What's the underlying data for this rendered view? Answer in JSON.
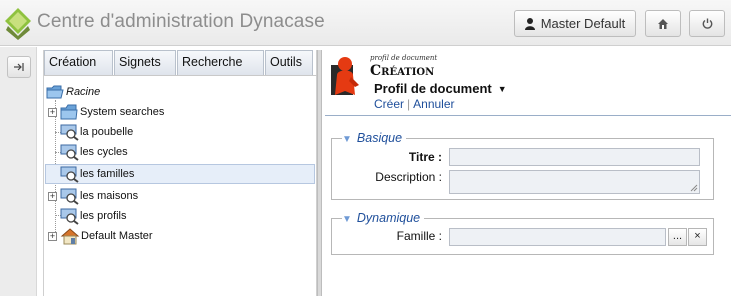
{
  "header": {
    "title": "Centre d'administration Dynacase",
    "user_label": "Master Default"
  },
  "menu": [
    {
      "label": "Création"
    },
    {
      "label": "Signets"
    },
    {
      "label": "Recherche"
    },
    {
      "label": "Outils"
    }
  ],
  "tree": {
    "root": "Racine",
    "items": [
      {
        "label": "System searches"
      },
      {
        "label": "la poubelle"
      },
      {
        "label": "les cycles"
      },
      {
        "label": "les familles"
      },
      {
        "label": "les maisons"
      },
      {
        "label": "les profils"
      },
      {
        "label": "Default Master"
      }
    ]
  },
  "document": {
    "caption": "profil de document",
    "title": "Création",
    "family_label": "Profil de document",
    "links": {
      "create": "Créer",
      "cancel": "Annuler"
    },
    "sections": {
      "basic": {
        "legend": "Basique",
        "title_label": "Titre :",
        "description_label": "Description :"
      },
      "dynamic": {
        "legend": "Dynamique",
        "family_label": "Famille :",
        "browse_label": "...",
        "clear_label": "×"
      }
    }
  }
}
